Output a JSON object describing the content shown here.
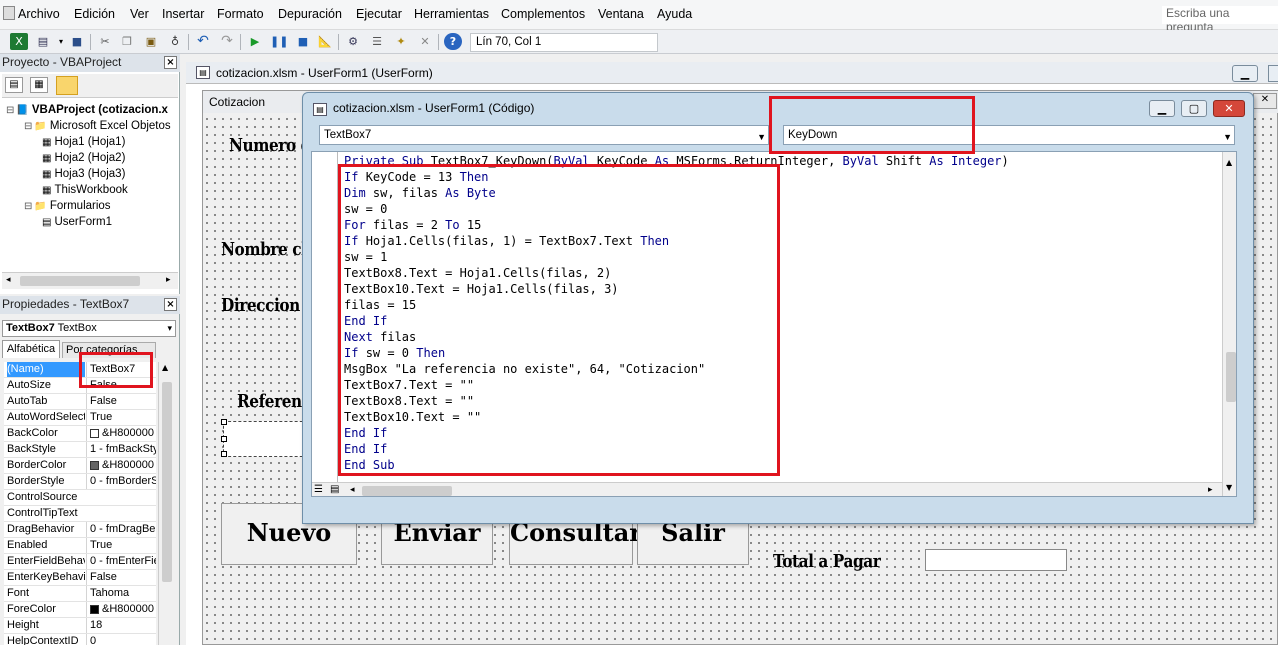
{
  "menubar": {
    "items": [
      {
        "label": "Archivo"
      },
      {
        "label": "Edición"
      },
      {
        "label": "Ver"
      },
      {
        "label": "Insertar"
      },
      {
        "label": "Formato"
      },
      {
        "label": "Depuración"
      },
      {
        "label": "Ejecutar"
      },
      {
        "label": "Herramientas"
      },
      {
        "label": "Complementos"
      },
      {
        "label": "Ventana"
      },
      {
        "label": "Ayuda"
      }
    ],
    "help_placeholder": "Escriba una pregunta"
  },
  "toolbar": {
    "cursor_position": "Lín 70, Col 1"
  },
  "project_panel": {
    "title": "Proyecto - VBAProject",
    "tree": [
      {
        "label": "VBAProject (cotizacion.x",
        "level": 0,
        "bold": true
      },
      {
        "label": "Microsoft Excel Objetos",
        "level": 1
      },
      {
        "label": "Hoja1 (Hoja1)",
        "level": 2
      },
      {
        "label": "Hoja2 (Hoja2)",
        "level": 2
      },
      {
        "label": "Hoja3 (Hoja3)",
        "level": 2
      },
      {
        "label": "ThisWorkbook",
        "level": 2
      },
      {
        "label": "Formularios",
        "level": 1
      },
      {
        "label": "UserForm1",
        "level": 2
      }
    ]
  },
  "properties_panel": {
    "title": "Propiedades - TextBox7",
    "object_name": "TextBox7",
    "object_type": "TextBox",
    "tabs": [
      "Alfabética",
      "Por categorías"
    ],
    "rows": [
      {
        "name": "(Name)",
        "value": "TextBox7",
        "selected": true
      },
      {
        "name": "AutoSize",
        "value": "False"
      },
      {
        "name": "AutoTab",
        "value": "False"
      },
      {
        "name": "AutoWordSelect",
        "value": "True"
      },
      {
        "name": "BackColor",
        "value": "&H800000",
        "swatch": "#ffffff"
      },
      {
        "name": "BackStyle",
        "value": "1 - fmBackStyle"
      },
      {
        "name": "BorderColor",
        "value": "&H800000",
        "swatch": "#646464"
      },
      {
        "name": "BorderStyle",
        "value": "0 - fmBorderSt"
      },
      {
        "name": "ControlSource",
        "value": ""
      },
      {
        "name": "ControlTipText",
        "value": ""
      },
      {
        "name": "DragBehavior",
        "value": "0 - fmDragBeh"
      },
      {
        "name": "Enabled",
        "value": "True"
      },
      {
        "name": "EnterFieldBehav",
        "value": "0 - fmEnterFiel"
      },
      {
        "name": "EnterKeyBehavi",
        "value": "False"
      },
      {
        "name": "Font",
        "value": "Tahoma"
      },
      {
        "name": "ForeColor",
        "value": "&H800000",
        "swatch": "#000000"
      },
      {
        "name": "Height",
        "value": "18"
      },
      {
        "name": "HelpContextID",
        "value": "0"
      }
    ]
  },
  "designer": {
    "title": "cotizacion.xlsm - UserForm1 (UserForm)",
    "form_caption": "Cotizacion",
    "labels": {
      "numero": "Numero d",
      "nombre": "Nombre cli",
      "direccion": "Direccion",
      "referencia": "Referenc",
      "total": "Total a Pagar"
    },
    "buttons": {
      "nuevo": "Nuevo",
      "enviar": "Enviar",
      "consultar": "Consultar",
      "salir": "Salir"
    }
  },
  "code_window": {
    "title": "cotizacion.xlsm - UserForm1 (Código)",
    "object_combo": "TextBox7",
    "procedure_combo": "KeyDown",
    "lines": [
      [
        {
          "t": "Private Sub ",
          "k": 1
        },
        {
          "t": "TextBox7_KeyDown(",
          "k": 0
        },
        {
          "t": "ByVal ",
          "k": 1
        },
        {
          "t": "KeyCode ",
          "k": 0
        },
        {
          "t": "As ",
          "k": 1
        },
        {
          "t": "MSForms.ReturnInteger, ",
          "k": 0
        },
        {
          "t": "ByVal ",
          "k": 1
        },
        {
          "t": "Shift ",
          "k": 0
        },
        {
          "t": "As Integer",
          "k": 1
        },
        {
          "t": ")",
          "k": 0
        }
      ],
      [
        {
          "t": "If ",
          "k": 1
        },
        {
          "t": "KeyCode = 13 ",
          "k": 0
        },
        {
          "t": "Then",
          "k": 1
        }
      ],
      [
        {
          "t": "Dim ",
          "k": 1
        },
        {
          "t": "sw, filas ",
          "k": 0
        },
        {
          "t": "As Byte",
          "k": 1
        }
      ],
      [
        {
          "t": "sw = 0",
          "k": 0
        }
      ],
      [
        {
          "t": "For ",
          "k": 1
        },
        {
          "t": "filas = 2 ",
          "k": 0
        },
        {
          "t": "To ",
          "k": 1
        },
        {
          "t": "15",
          "k": 0
        }
      ],
      [
        {
          "t": "If ",
          "k": 1
        },
        {
          "t": "Hoja1.Cells(filas, 1) = TextBox7.Text ",
          "k": 0
        },
        {
          "t": "Then",
          "k": 1
        }
      ],
      [
        {
          "t": "sw = 1",
          "k": 0
        }
      ],
      [
        {
          "t": "TextBox8.Text = Hoja1.Cells(filas, 2)",
          "k": 0
        }
      ],
      [
        {
          "t": "TextBox10.Text = Hoja1.Cells(filas, 3)",
          "k": 0
        }
      ],
      [
        {
          "t": "filas = 15",
          "k": 0
        }
      ],
      [
        {
          "t": "End If",
          "k": 1
        }
      ],
      [
        {
          "t": "Next ",
          "k": 1
        },
        {
          "t": "filas",
          "k": 0
        }
      ],
      [
        {
          "t": "If ",
          "k": 1
        },
        {
          "t": "sw = 0 ",
          "k": 0
        },
        {
          "t": "Then",
          "k": 1
        }
      ],
      [
        {
          "t": "MsgBox \"La referencia no existe\", 64, \"Cotizacion\"",
          "k": 0
        }
      ],
      [
        {
          "t": "TextBox7.Text = \"\"",
          "k": 0
        }
      ],
      [
        {
          "t": "TextBox8.Text = \"\"",
          "k": 0
        }
      ],
      [
        {
          "t": "TextBox10.Text = \"\"",
          "k": 0
        }
      ],
      [
        {
          "t": "End If",
          "k": 1
        }
      ],
      [
        {
          "t": "End If",
          "k": 1
        }
      ],
      [
        {
          "t": "End Sub",
          "k": 1
        }
      ]
    ]
  },
  "colors": {
    "keyword": "#00008b",
    "highlight_box": "#e0141e",
    "selected_property": "#3399ff"
  }
}
